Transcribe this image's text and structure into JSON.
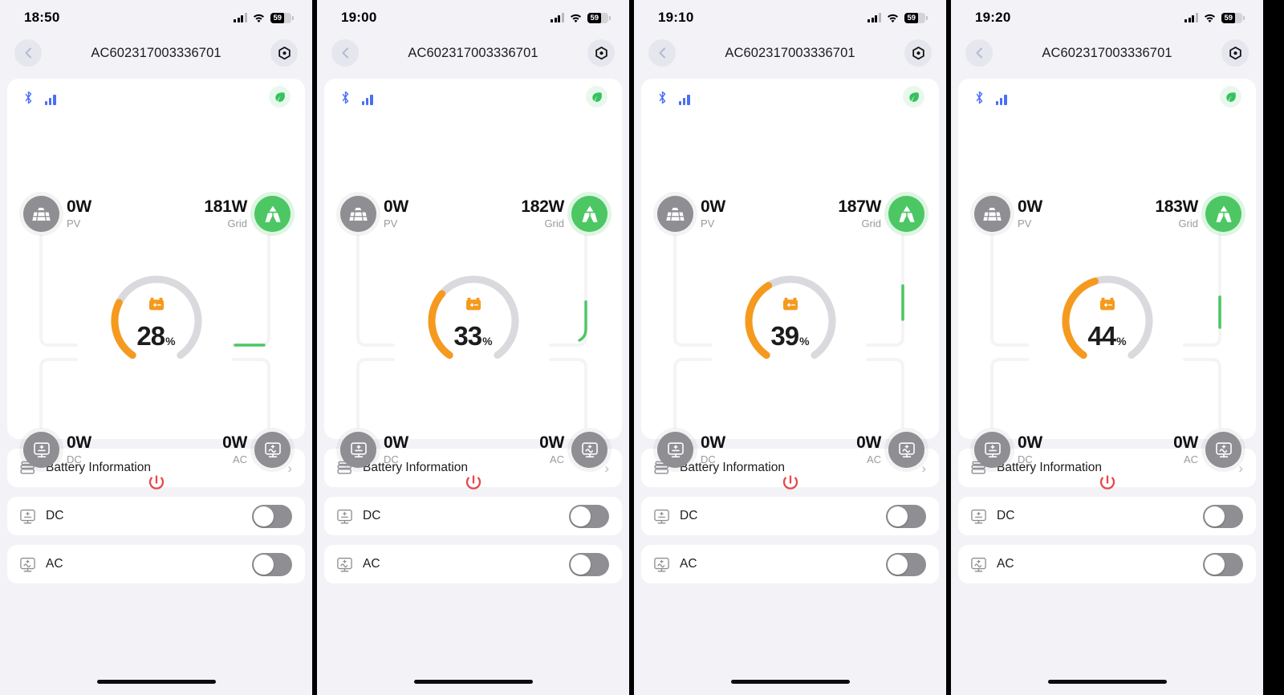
{
  "panels": [
    {
      "status": {
        "time": "18:50",
        "battery_pct": "59",
        "wifi": "wifi-icon",
        "cellular": "signal-bars-icon"
      },
      "nav": {
        "back": "back-chevron-icon",
        "title": "AC602317003336701",
        "settings": "gear-hex-icon"
      },
      "card": {
        "bluetooth_icon": "bluetooth-icon",
        "signal_icon": "device-signal-icon",
        "eco_icon": "leaf-icon",
        "pv": {
          "value": "0W",
          "label": "PV",
          "icon": "solar-panel-icon",
          "active": false
        },
        "grid": {
          "value": "181W",
          "label": "Grid",
          "icon": "power-tower-icon",
          "active": true
        },
        "dc": {
          "value": "0W",
          "label": "DC",
          "icon": "dc-output-icon",
          "active": false
        },
        "ac": {
          "value": "0W",
          "label": "AC",
          "icon": "ac-output-icon",
          "active": false
        },
        "battery": {
          "percent": 28,
          "percent_text": "28",
          "unit": "%",
          "icon": "battery-icon"
        },
        "power_icon": "power-button-icon",
        "flow_segment": "horizontal"
      },
      "rows": [
        {
          "icon": "battery-stack-icon",
          "label": "Battery Information",
          "control": "chevron",
          "chevron": "›"
        },
        {
          "icon": "dc-output-icon",
          "label": "DC",
          "control": "toggle",
          "on": false
        },
        {
          "icon": "ac-output-icon",
          "label": "AC",
          "control": "toggle",
          "on": false
        }
      ]
    },
    {
      "status": {
        "time": "19:00",
        "battery_pct": "59",
        "wifi": "wifi-icon",
        "cellular": "signal-bars-icon"
      },
      "nav": {
        "back": "back-chevron-icon",
        "title": "AC602317003336701",
        "settings": "gear-hex-icon"
      },
      "card": {
        "bluetooth_icon": "bluetooth-icon",
        "signal_icon": "device-signal-icon",
        "eco_icon": "leaf-icon",
        "pv": {
          "value": "0W",
          "label": "PV",
          "icon": "solar-panel-icon",
          "active": false
        },
        "grid": {
          "value": "182W",
          "label": "Grid",
          "icon": "power-tower-icon",
          "active": true
        },
        "dc": {
          "value": "0W",
          "label": "DC",
          "icon": "dc-output-icon",
          "active": false
        },
        "ac": {
          "value": "0W",
          "label": "AC",
          "icon": "ac-output-icon",
          "active": false
        },
        "battery": {
          "percent": 33,
          "percent_text": "33",
          "unit": "%",
          "icon": "battery-icon"
        },
        "power_icon": "power-button-icon",
        "flow_segment": "corner"
      },
      "rows": [
        {
          "icon": "battery-stack-icon",
          "label": "Battery Information",
          "control": "chevron",
          "chevron": "›"
        },
        {
          "icon": "dc-output-icon",
          "label": "DC",
          "control": "toggle",
          "on": false
        },
        {
          "icon": "ac-output-icon",
          "label": "AC",
          "control": "toggle",
          "on": false
        }
      ]
    },
    {
      "status": {
        "time": "19:10",
        "battery_pct": "59",
        "wifi": "wifi-icon",
        "cellular": "signal-bars-icon"
      },
      "nav": {
        "back": "back-chevron-icon",
        "title": "AC602317003336701",
        "settings": "gear-hex-icon"
      },
      "card": {
        "bluetooth_icon": "bluetooth-icon",
        "signal_icon": "device-signal-icon",
        "eco_icon": "leaf-icon",
        "pv": {
          "value": "0W",
          "label": "PV",
          "icon": "solar-panel-icon",
          "active": false
        },
        "grid": {
          "value": "187W",
          "label": "Grid",
          "icon": "power-tower-icon",
          "active": true
        },
        "dc": {
          "value": "0W",
          "label": "DC",
          "icon": "dc-output-icon",
          "active": false
        },
        "ac": {
          "value": "0W",
          "label": "AC",
          "icon": "ac-output-icon",
          "active": false
        },
        "battery": {
          "percent": 39,
          "percent_text": "39",
          "unit": "%",
          "icon": "battery-icon"
        },
        "power_icon": "power-button-icon",
        "flow_segment": "vertical"
      },
      "rows": [
        {
          "icon": "battery-stack-icon",
          "label": "Battery Information",
          "control": "chevron",
          "chevron": "›"
        },
        {
          "icon": "dc-output-icon",
          "label": "DC",
          "control": "toggle",
          "on": false
        },
        {
          "icon": "ac-output-icon",
          "label": "AC",
          "control": "toggle",
          "on": false
        }
      ]
    },
    {
      "status": {
        "time": "19:20",
        "battery_pct": "59",
        "wifi": "wifi-icon",
        "cellular": "signal-bars-icon"
      },
      "nav": {
        "back": "back-chevron-icon",
        "title": "AC602317003336701",
        "settings": "gear-hex-icon"
      },
      "card": {
        "bluetooth_icon": "bluetooth-icon",
        "signal_icon": "device-signal-icon",
        "eco_icon": "leaf-icon",
        "pv": {
          "value": "0W",
          "label": "PV",
          "icon": "solar-panel-icon",
          "active": false
        },
        "grid": {
          "value": "183W",
          "label": "Grid",
          "icon": "power-tower-icon",
          "active": true
        },
        "dc": {
          "value": "0W",
          "label": "DC",
          "icon": "dc-output-icon",
          "active": false
        },
        "ac": {
          "value": "0W",
          "label": "AC",
          "icon": "ac-output-icon",
          "active": false
        },
        "battery": {
          "percent": 44,
          "percent_text": "44",
          "unit": "%",
          "icon": "battery-icon"
        },
        "power_icon": "power-button-icon",
        "flow_segment": "vertical-low"
      },
      "rows": [
        {
          "icon": "battery-stack-icon",
          "label": "Battery Information",
          "control": "chevron",
          "chevron": "›"
        },
        {
          "icon": "dc-output-icon",
          "label": "DC",
          "control": "toggle",
          "on": false
        },
        {
          "icon": "ac-output-icon",
          "label": "AC",
          "control": "toggle",
          "on": false
        }
      ]
    }
  ],
  "colors": {
    "accent_orange": "#f59a1e",
    "grid_green": "#4cc764",
    "flow_green": "#4cc764",
    "node_gray": "#8e8e93",
    "track_gray": "#d9d9de",
    "power_red": "#e8484a",
    "bluetooth_blue": "#4a6ef5",
    "page_bg": "#f2f2f7",
    "card_bg": "#ffffff"
  }
}
